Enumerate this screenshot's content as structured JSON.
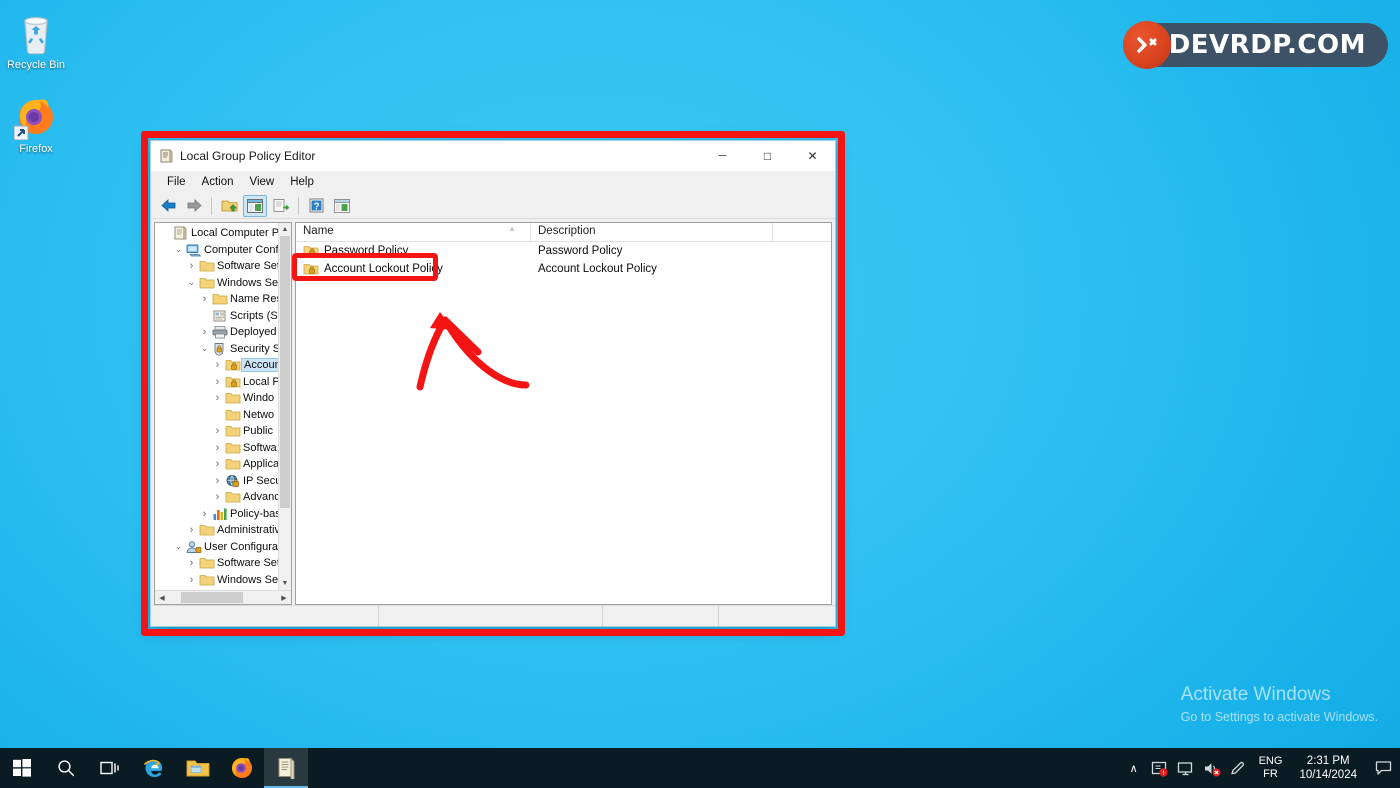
{
  "desktop": {
    "icons": [
      {
        "label": "Recycle Bin",
        "icon": "recycle-bin-icon"
      },
      {
        "label": "Firefox",
        "icon": "firefox-icon"
      }
    ],
    "watermark": {
      "title": "Activate Windows",
      "subtitle": "Go to Settings to activate Windows."
    }
  },
  "branding": {
    "wordmark": "DEVRDP.COM",
    "badge_icon": "remote-desktop-icon",
    "badge_color": "#d8431f",
    "plate_color": "#3d5266"
  },
  "window": {
    "title": "Local Group Policy Editor",
    "icon": "mmc-console-icon",
    "controls": {
      "minimize": "─",
      "maximize": "□",
      "close": "✕"
    },
    "menu": [
      "File",
      "Action",
      "View",
      "Help"
    ],
    "toolbar": [
      {
        "name": "back-button",
        "icon": "back-arrow-icon",
        "pressed": false
      },
      {
        "name": "forward-button",
        "icon": "forward-arrow-icon",
        "pressed": false
      },
      {
        "name": "separator",
        "icon": "separator",
        "pressed": false
      },
      {
        "name": "up-one-level-button",
        "icon": "up-folder-icon",
        "pressed": false
      },
      {
        "name": "show-hide-console-tree-button",
        "icon": "console-tree-icon",
        "pressed": true
      },
      {
        "name": "export-list-button",
        "icon": "export-list-icon",
        "pressed": false
      },
      {
        "name": "separator",
        "icon": "separator",
        "pressed": false
      },
      {
        "name": "help-button",
        "icon": "help-question-icon",
        "pressed": false
      },
      {
        "name": "view-button",
        "icon": "view-window-icon",
        "pressed": false
      }
    ]
  },
  "tree": {
    "items": [
      {
        "label": "Local Computer Policy",
        "depth": 0,
        "twisty": "",
        "icon": "console-root-icon",
        "selected": false
      },
      {
        "label": "Computer Configu",
        "depth": 1,
        "twisty": "v",
        "icon": "computer-icon",
        "selected": false
      },
      {
        "label": "Software Setti",
        "depth": 2,
        "twisty": ">",
        "icon": "folder-icon",
        "selected": false
      },
      {
        "label": "Windows Setti",
        "depth": 2,
        "twisty": "v",
        "icon": "folder-icon",
        "selected": false
      },
      {
        "label": "Name Reso",
        "depth": 3,
        "twisty": ">",
        "icon": "folder-icon",
        "selected": false
      },
      {
        "label": "Scripts (Sta",
        "depth": 3,
        "twisty": "",
        "icon": "script-icon",
        "selected": false
      },
      {
        "label": "Deployed",
        "depth": 3,
        "twisty": ">",
        "icon": "printer-icon",
        "selected": false
      },
      {
        "label": "Security Se",
        "depth": 3,
        "twisty": "v",
        "icon": "security-shield-icon",
        "selected": false
      },
      {
        "label": "Accoun",
        "depth": 4,
        "twisty": ">",
        "icon": "locked-folder-icon",
        "selected": true
      },
      {
        "label": "Local P",
        "depth": 4,
        "twisty": ">",
        "icon": "locked-folder-icon",
        "selected": false
      },
      {
        "label": "Windo",
        "depth": 4,
        "twisty": ">",
        "icon": "folder-icon",
        "selected": false
      },
      {
        "label": "Netwo",
        "depth": 4,
        "twisty": "",
        "icon": "folder-icon",
        "selected": false
      },
      {
        "label": "Public",
        "depth": 4,
        "twisty": ">",
        "icon": "folder-icon",
        "selected": false
      },
      {
        "label": "Softwa",
        "depth": 4,
        "twisty": ">",
        "icon": "folder-icon",
        "selected": false
      },
      {
        "label": "Applica",
        "depth": 4,
        "twisty": ">",
        "icon": "folder-icon",
        "selected": false
      },
      {
        "label": "IP Secu",
        "depth": 4,
        "twisty": ">",
        "icon": "ip-security-icon",
        "selected": false
      },
      {
        "label": "Advanc",
        "depth": 4,
        "twisty": ">",
        "icon": "folder-icon",
        "selected": false
      },
      {
        "label": "Policy-bas",
        "depth": 3,
        "twisty": ">",
        "icon": "qos-chart-icon",
        "selected": false
      },
      {
        "label": "Administrative",
        "depth": 2,
        "twisty": ">",
        "icon": "folder-icon",
        "selected": false
      },
      {
        "label": "User Configuratio",
        "depth": 1,
        "twisty": "v",
        "icon": "user-icon",
        "selected": false
      },
      {
        "label": "Software Setti",
        "depth": 2,
        "twisty": ">",
        "icon": "folder-icon",
        "selected": false
      },
      {
        "label": "Windows Setti",
        "depth": 2,
        "twisty": ">",
        "icon": "folder-icon",
        "selected": false
      }
    ]
  },
  "list": {
    "columns": [
      "Name",
      "Description"
    ],
    "rows": [
      {
        "name": "Password Policy",
        "description": "Password Policy",
        "icon": "locked-folder-icon"
      },
      {
        "name": "Account Lockout Policy",
        "description": "Account Lockout Policy",
        "icon": "locked-folder-icon"
      }
    ]
  },
  "annotations": {
    "highlight_target": "Account Lockout Policy",
    "color": "#f41414"
  },
  "taskbar": {
    "items": [
      {
        "name": "start-button",
        "icon": "windows-logo-icon",
        "active": false
      },
      {
        "name": "search-button",
        "icon": "search-icon",
        "active": false
      },
      {
        "name": "task-view-button",
        "icon": "task-view-icon",
        "active": false
      },
      {
        "name": "internet-explorer",
        "icon": "internet-explorer-icon",
        "active": false
      },
      {
        "name": "file-explorer",
        "icon": "file-explorer-icon",
        "active": false
      },
      {
        "name": "firefox",
        "icon": "firefox-icon",
        "active": false
      },
      {
        "name": "group-policy-editor",
        "icon": "mmc-console-icon",
        "active": true
      }
    ],
    "tray": {
      "chevron": "∧",
      "icons": [
        "security-notification-icon",
        "network-monitor-icon",
        "volume-muted-icon",
        "pen-settings-icon"
      ],
      "language_top": "ENG",
      "language_bottom": "FR",
      "time": "2:31 PM",
      "date": "10/14/2024",
      "action_center": "action-center-icon"
    }
  }
}
